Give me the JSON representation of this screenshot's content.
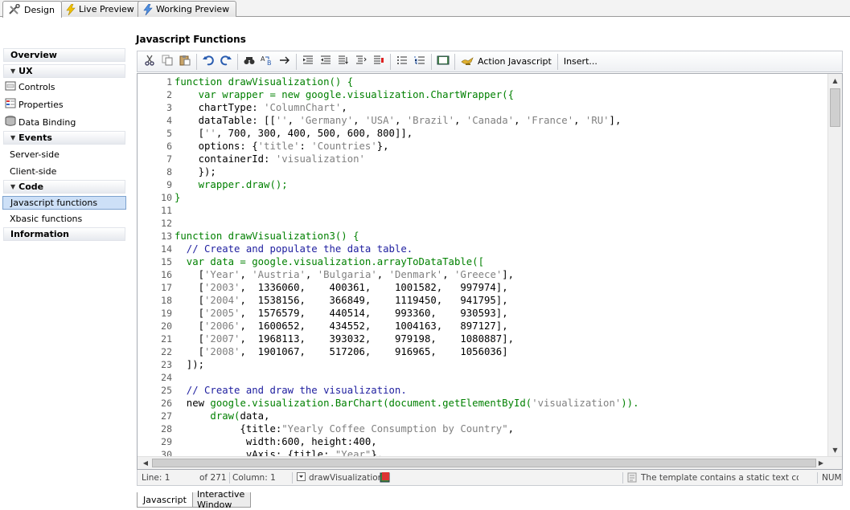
{
  "top_tabs": [
    {
      "label": "Design",
      "icon": "tools-icon",
      "active": true
    },
    {
      "label": "Live Preview",
      "icon": "lightning-yellow-icon"
    },
    {
      "label": "Working Preview",
      "icon": "lightning-blue-icon"
    }
  ],
  "sidebar": {
    "overview": "Overview",
    "ux": "UX",
    "ux_items": [
      "Controls",
      "Properties",
      "Data Binding"
    ],
    "events": "Events",
    "events_items": [
      "Server-side",
      "Client-side"
    ],
    "code": "Code",
    "code_items": [
      "Javascript functions",
      "Xbasic functions"
    ],
    "information": "Information"
  },
  "page_title": "Javascript Functions",
  "toolbar": {
    "icons": [
      "cut-icon",
      "copy-icon",
      "paste-icon",
      "undo-icon",
      "redo-icon",
      "find-icon",
      "replace-icon",
      "goto-icon",
      "indent-icon",
      "outdent-icon",
      "comment-icon",
      "uncomment-icon",
      "bookmark-icon",
      "bullet-list-icon",
      "number-list-icon",
      "book-icon"
    ],
    "action_javascript": "Action Javascript",
    "insert": "Insert..."
  },
  "code_lines": [
    [
      [
        "function drawVisualization() {",
        "kw"
      ]
    ],
    [
      [
        "    var wrapper = new ",
        "kw"
      ],
      [
        "google.visualization.ChartWrapper({",
        "fn"
      ]
    ],
    [
      [
        "    chartType: ",
        "op"
      ],
      [
        "'ColumnChart'",
        "str"
      ],
      [
        ",",
        "op"
      ]
    ],
    [
      [
        "    dataTable: [[",
        "op"
      ],
      [
        "''",
        "str"
      ],
      [
        ", ",
        "op"
      ],
      [
        "'Germany'",
        "str"
      ],
      [
        ", ",
        "op"
      ],
      [
        "'USA'",
        "str"
      ],
      [
        ", ",
        "op"
      ],
      [
        "'Brazil'",
        "str"
      ],
      [
        ", ",
        "op"
      ],
      [
        "'Canada'",
        "str"
      ],
      [
        ", ",
        "op"
      ],
      [
        "'France'",
        "str"
      ],
      [
        ", ",
        "op"
      ],
      [
        "'RU'",
        "str"
      ],
      [
        "],",
        "op"
      ]
    ],
    [
      [
        "    [",
        "op"
      ],
      [
        "''",
        "str"
      ],
      [
        ", 700, 300, 400, 500, 600, 800]],",
        "op"
      ]
    ],
    [
      [
        "    options: {",
        "op"
      ],
      [
        "'title'",
        "str"
      ],
      [
        ": ",
        "op"
      ],
      [
        "'Countries'",
        "str"
      ],
      [
        "},",
        "op"
      ]
    ],
    [
      [
        "    containerId: ",
        "op"
      ],
      [
        "'visualization'",
        "str"
      ]
    ],
    [
      [
        "    });",
        "op"
      ]
    ],
    [
      [
        "    wrapper.draw();",
        "kw"
      ]
    ],
    [
      [
        "}",
        "kw"
      ]
    ],
    [],
    [],
    [
      [
        "function drawVisualization3() {",
        "kw"
      ]
    ],
    [
      [
        "  // Create and populate the data table.",
        "cm"
      ]
    ],
    [
      [
        "  var data = ",
        "kw"
      ],
      [
        "google.visualization.arrayToDataTable([",
        "fn"
      ]
    ],
    [
      [
        "    [",
        "op"
      ],
      [
        "'Year'",
        "str"
      ],
      [
        ", ",
        "op"
      ],
      [
        "'Austria'",
        "str"
      ],
      [
        ", ",
        "op"
      ],
      [
        "'Bulgaria'",
        "str"
      ],
      [
        ", ",
        "op"
      ],
      [
        "'Denmark'",
        "str"
      ],
      [
        ", ",
        "op"
      ],
      [
        "'Greece'",
        "str"
      ],
      [
        "],",
        "op"
      ]
    ],
    [
      [
        "    [",
        "op"
      ],
      [
        "'2003'",
        "str"
      ],
      [
        ",  1336060,    400361,    1001582,   997974],",
        "op"
      ]
    ],
    [
      [
        "    [",
        "op"
      ],
      [
        "'2004'",
        "str"
      ],
      [
        ",  1538156,    366849,    1119450,   941795],",
        "op"
      ]
    ],
    [
      [
        "    [",
        "op"
      ],
      [
        "'2005'",
        "str"
      ],
      [
        ",  1576579,    440514,    993360,    930593],",
        "op"
      ]
    ],
    [
      [
        "    [",
        "op"
      ],
      [
        "'2006'",
        "str"
      ],
      [
        ",  1600652,    434552,    1004163,   897127],",
        "op"
      ]
    ],
    [
      [
        "    [",
        "op"
      ],
      [
        "'2007'",
        "str"
      ],
      [
        ",  1968113,    393032,    979198,    1080887],",
        "op"
      ]
    ],
    [
      [
        "    [",
        "op"
      ],
      [
        "'2008'",
        "str"
      ],
      [
        ",  1901067,    517206,    916965,    1056036]",
        "op"
      ]
    ],
    [
      [
        "  ]);",
        "op"
      ]
    ],
    [],
    [
      [
        "  // Create and draw the visualization.",
        "cm"
      ]
    ],
    [
      [
        "  new ",
        "op"
      ],
      [
        "google.visualization.BarChart(document.getElementById(",
        "fn"
      ],
      [
        "'visualization'",
        "str"
      ],
      [
        ")).",
        "fn"
      ]
    ],
    [
      [
        "      draw(",
        "kw"
      ],
      [
        "data,",
        "op"
      ]
    ],
    [
      [
        "           {title:",
        "op"
      ],
      [
        "\"Yearly Coffee Consumption by Country\"",
        "str"
      ],
      [
        ",",
        "op"
      ]
    ],
    [
      [
        "            width:600, height:400,",
        "op"
      ]
    ],
    [
      [
        "            vAxis: {title: ",
        "op"
      ],
      [
        "\"Year\"",
        "str"
      ],
      [
        "},",
        "op"
      ]
    ]
  ],
  "status": {
    "line": "Line: 1",
    "of": "of 271",
    "column": "Column: 1",
    "function": "drawVisualization",
    "message": "The template contains a static text conti",
    "num": "NUM"
  },
  "bottom_tabs": [
    "Javascript",
    "Interactive Window"
  ]
}
